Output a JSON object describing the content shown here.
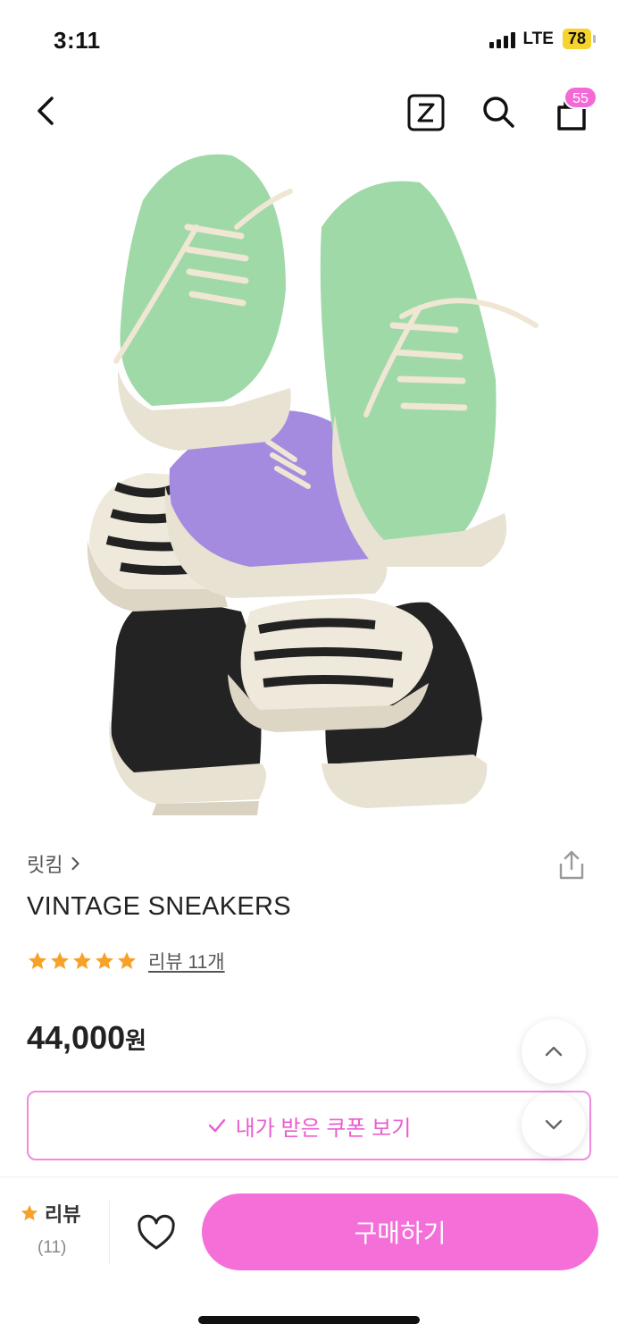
{
  "status_bar": {
    "time": "3:11",
    "network": "LTE",
    "battery": "78"
  },
  "nav": {
    "back_icon": "chevron-left-icon",
    "z_icon": "z-box-icon",
    "search_icon": "search-icon",
    "cart_icon": "cart-bag-icon",
    "cart_count": "55"
  },
  "hero": {
    "image": "sneakers-stack-photo"
  },
  "product": {
    "brand": "릿킴",
    "title": "VINTAGE SNEAKERS",
    "rating_stars": 5,
    "review_link": "리뷰 11개",
    "price": "44,000",
    "currency": "원"
  },
  "coupon": {
    "label": "내가 받은 쿠폰 보기"
  },
  "colors": {
    "accent": "#f56fd8",
    "accent_border": "#f08ae0",
    "star": "#f7a128"
  },
  "bottom_bar": {
    "review_label": "리뷰",
    "review_count": "(11)",
    "buy_label": "구매하기"
  }
}
